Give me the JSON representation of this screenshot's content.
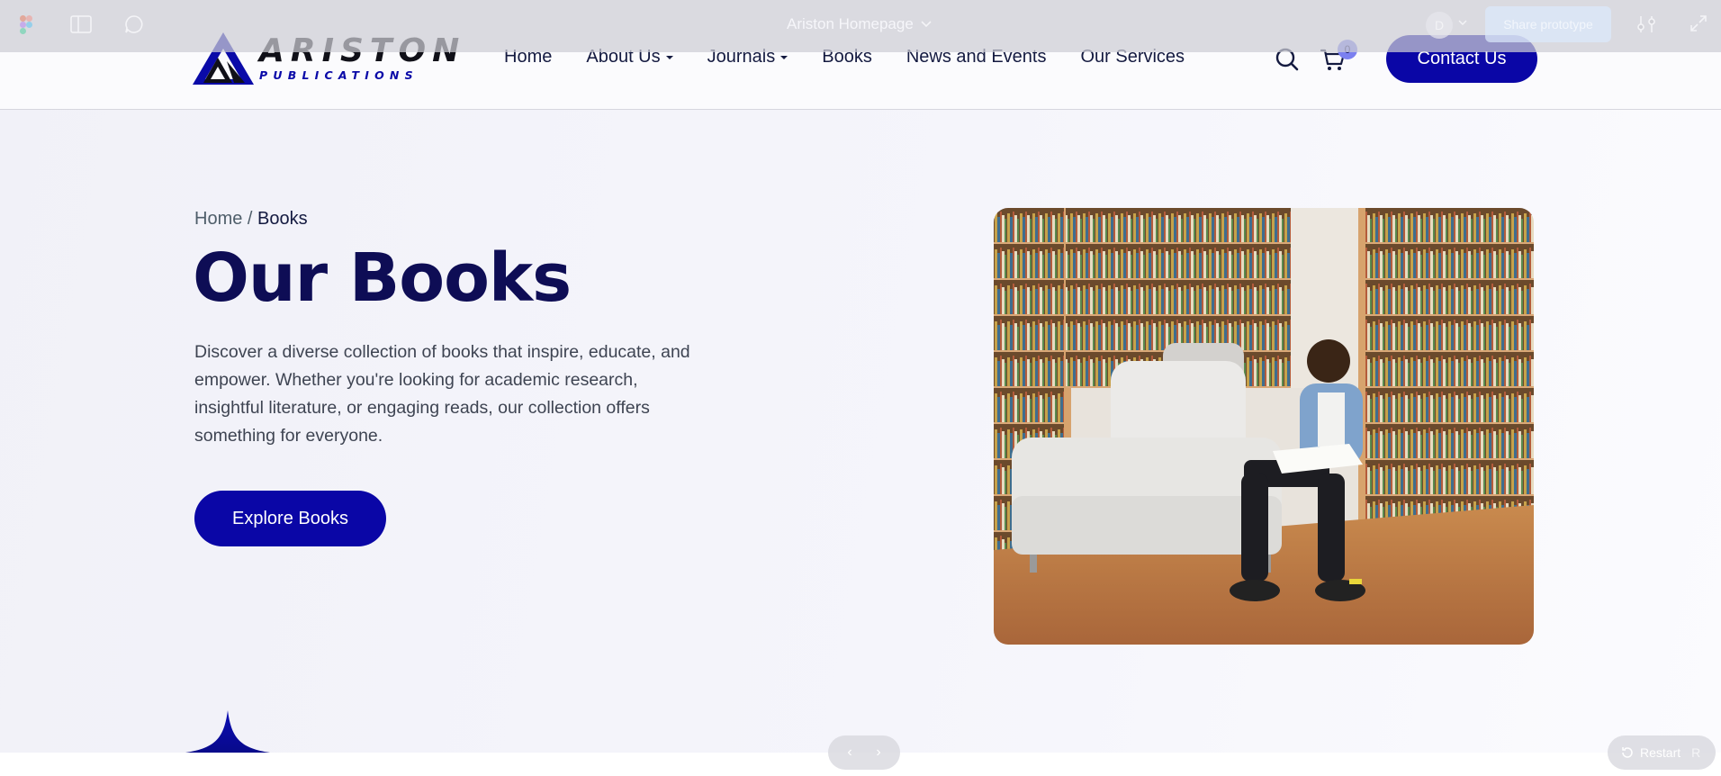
{
  "site": {
    "logo": {
      "title": "ARISTON",
      "subtitle": "PUBLICATIONS"
    },
    "nav": [
      {
        "label": "Home",
        "has_dropdown": false
      },
      {
        "label": "About Us",
        "has_dropdown": true
      },
      {
        "label": "Journals",
        "has_dropdown": true
      },
      {
        "label": "Books",
        "has_dropdown": false
      },
      {
        "label": "News and Events",
        "has_dropdown": false
      },
      {
        "label": "Our Services",
        "has_dropdown": false
      }
    ],
    "cart_count": "0",
    "contact_label": "Contact Us"
  },
  "hero": {
    "breadcrumb": {
      "home": "Home",
      "separator": " / ",
      "current": "Books"
    },
    "title": "Our Books",
    "description": "Discover a diverse collection of books that inspire, educate, and empower. Whether you're looking for academic research, insightful literature, or engaging reads, our collection offers something for everyone.",
    "cta_label": "Explore Books"
  },
  "prototype_viewer": {
    "file_title": "Ariston Homepage",
    "avatar_initial": "D",
    "share_label": "Share prototype",
    "restart_label": "Restart",
    "restart_key": "R"
  },
  "colors": {
    "brand_blue": "#0a06a6",
    "heading_navy": "#0e0d55",
    "badge": "#7b80f0"
  }
}
